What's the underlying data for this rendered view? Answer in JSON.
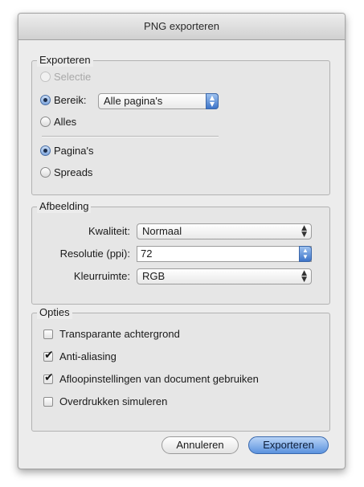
{
  "dialog": {
    "title": "PNG exporteren"
  },
  "export_group": {
    "label": "Exporteren",
    "selection_label": "Selectie",
    "range_label": "Bereik:",
    "range_value": "Alle pagina's",
    "all_label": "Alles",
    "pages_label": "Pagina's",
    "spreads_label": "Spreads",
    "selected_range_option": "Bereik:",
    "selected_layout_option": "Pagina's"
  },
  "image_group": {
    "label": "Afbeelding",
    "quality_label": "Kwaliteit:",
    "quality_value": "Normaal",
    "resolution_label": "Resolutie (ppi):",
    "resolution_value": "72",
    "colorspace_label": "Kleurruimte:",
    "colorspace_value": "RGB"
  },
  "options_group": {
    "label": "Opties",
    "items": [
      {
        "label": "Transparante achtergrond",
        "checked": false
      },
      {
        "label": "Anti-aliasing",
        "checked": true
      },
      {
        "label": "Afloopinstellingen van document gebruiken",
        "checked": true
      },
      {
        "label": "Overdrukken simuleren",
        "checked": false
      }
    ]
  },
  "buttons": {
    "cancel_label": "Annuleren",
    "export_label": "Exporteren"
  },
  "colors": {
    "dialog_bg": "#ececec",
    "accent_blue": "#5b92de"
  }
}
